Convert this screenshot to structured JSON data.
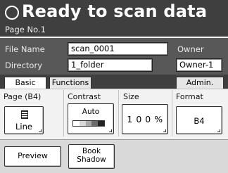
{
  "header": {
    "title": "Ready to scan data",
    "page_no": "Page No.1",
    "icon": "ready-circle-icon"
  },
  "info": {
    "file_name_label": "File Name",
    "file_name_value": "scan_0001",
    "owner_label": "Owner",
    "directory_label": "Directory",
    "directory_value": "1_folder",
    "owner_value": "Owner-1"
  },
  "tabs": [
    {
      "label": "Basic",
      "active": true
    },
    {
      "label": "Functions",
      "active": false
    },
    {
      "label": "Admin.",
      "active": false
    }
  ],
  "settings": {
    "page": {
      "label": "Page (B4)",
      "value": "Line",
      "icon": "line-document-icon"
    },
    "contrast": {
      "label": "Contrast",
      "value": "Auto",
      "levels": [
        "#ffffff",
        "#d8d8d8",
        "#a8a8a8",
        "#6a6a6a",
        "#222222"
      ]
    },
    "size": {
      "label": "Size",
      "value": "1 0 0 %"
    },
    "format": {
      "label": "Format",
      "value": "B4"
    }
  },
  "bottom": {
    "preview_label": "Preview",
    "book_shadow_line1": "Book",
    "book_shadow_line2": "Shadow"
  },
  "colors": {
    "header_bg": "#3f3f3f",
    "info_bg": "#585858",
    "panel_bg": "#f2f2f2",
    "bottom_bg": "#d9d9d9"
  }
}
